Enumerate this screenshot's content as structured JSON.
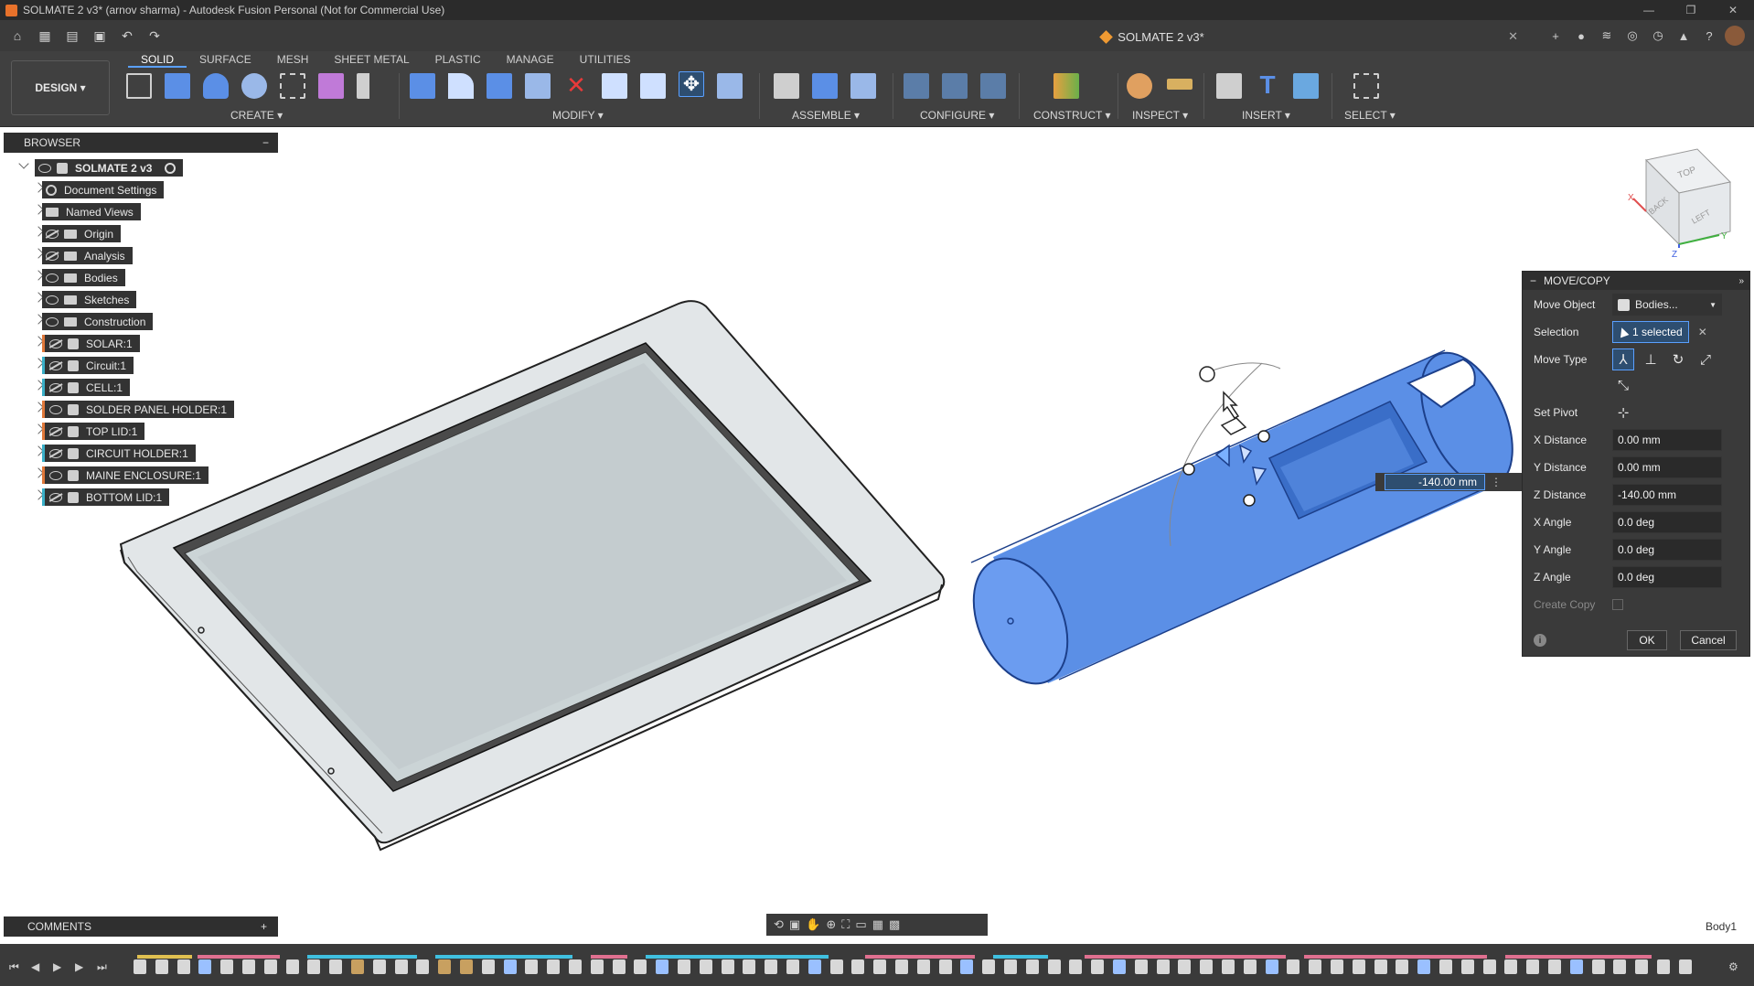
{
  "titlebar": {
    "title": "SOLMATE 2 v3* (arnov sharma) - Autodesk Fusion Personal (Not for Commercial Use)",
    "minimize": "—",
    "restore": "❐",
    "close": "✕"
  },
  "tabbar": {
    "doc_tab": "SOLMATE 2 v3*",
    "close": "✕"
  },
  "toolbar": {
    "design_label": "DESIGN ▾",
    "workspace_tabs": [
      "SOLID",
      "SURFACE",
      "MESH",
      "SHEET METAL",
      "PLASTIC",
      "MANAGE",
      "UTILITIES"
    ],
    "active_tab": "SOLID",
    "groups": {
      "create": "CREATE ▾",
      "modify": "MODIFY ▾",
      "assemble": "ASSEMBLE ▾",
      "configure": "CONFIGURE ▾",
      "construct": "CONSTRUCT ▾",
      "inspect": "INSPECT ▾",
      "insert": "INSERT ▾",
      "select": "SELECT ▾"
    }
  },
  "browser": {
    "title": "BROWSER",
    "collapse": "−",
    "items": [
      {
        "label": "SOLMATE 2 v3",
        "icon": "document-icon",
        "eye": "on",
        "root": true
      },
      {
        "label": "Document Settings",
        "icon": "gear-icon"
      },
      {
        "label": "Named Views",
        "icon": "folder-icon"
      },
      {
        "label": "Origin",
        "icon": "folder-icon",
        "eye": "off"
      },
      {
        "label": "Analysis",
        "icon": "folder-icon",
        "eye": "off"
      },
      {
        "label": "Bodies",
        "icon": "folder-icon",
        "eye": "on"
      },
      {
        "label": "Sketches",
        "icon": "folder-icon",
        "eye": "on"
      },
      {
        "label": "Construction",
        "icon": "folder-icon",
        "eye": "on"
      },
      {
        "label": "SOLAR:1",
        "icon": "component-icon",
        "eye": "off",
        "color": "#e0783a"
      },
      {
        "label": "Circuit:1",
        "icon": "component-icon",
        "eye": "off",
        "color": "#3ab0c8"
      },
      {
        "label": "CELL:1",
        "icon": "component-icon",
        "eye": "off",
        "color": "#3ab0c8"
      },
      {
        "label": "SOLDER PANEL HOLDER:1",
        "icon": "component-icon",
        "eye": "on",
        "color": "#e0783a"
      },
      {
        "label": "TOP LID:1",
        "icon": "component-icon",
        "eye": "off",
        "color": "#e0783a"
      },
      {
        "label": "CIRCUIT HOLDER:1",
        "icon": "component-icon",
        "eye": "off",
        "color": "#3ab0c8"
      },
      {
        "label": "MAINE ENCLOSURE:1",
        "icon": "component-icon",
        "eye": "on",
        "color": "#e0783a"
      },
      {
        "label": "BOTTOM LID:1",
        "icon": "component-icon",
        "eye": "off",
        "color": "#3ab0c8"
      }
    ]
  },
  "comments": {
    "label": "COMMENTS",
    "add": "+"
  },
  "dialog": {
    "title": "MOVE/COPY",
    "fields": {
      "move_object_label": "Move Object",
      "move_object_value": "Bodies...",
      "selection_label": "Selection",
      "selection_value": "1 selected",
      "move_type_label": "Move Type",
      "set_pivot_label": "Set Pivot",
      "x_distance_label": "X Distance",
      "x_distance_value": "0.00 mm",
      "y_distance_label": "Y Distance",
      "y_distance_value": "0.00 mm",
      "z_distance_label": "Z Distance",
      "z_distance_value": "-140.00 mm",
      "x_angle_label": "X Angle",
      "x_angle_value": "0.0 deg",
      "y_angle_label": "Y Angle",
      "y_angle_value": "0.0 deg",
      "z_angle_label": "Z Angle",
      "z_angle_value": "0.0 deg",
      "create_copy_label": "Create Copy"
    },
    "ok": "OK",
    "cancel": "Cancel",
    "info": "i"
  },
  "viewport": {
    "dimension_input": "-140.00 mm",
    "viewcube_faces": [
      "TOP",
      "BACK",
      "LEFT"
    ],
    "axis_labels": [
      "X",
      "Y",
      "Z"
    ],
    "status_body": "Body1"
  },
  "colors": {
    "accent_blue": "#5aa0ff",
    "body_blue": "#5b8fe6",
    "panel": "#404040",
    "tray": "#dfe3e5"
  }
}
